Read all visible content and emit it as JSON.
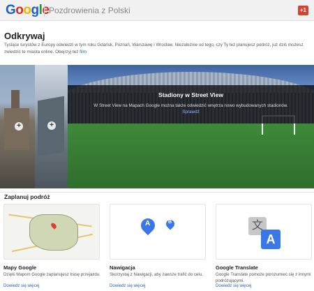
{
  "header": {
    "logo_letters": [
      "G",
      "o",
      "o",
      "g",
      "l",
      "e"
    ],
    "title": "Pozdrowienia z Polski",
    "gplus_label": "+1"
  },
  "discover": {
    "heading": "Odkrywaj",
    "intro": "Tysiące turystów z Europy odwiedzi w tym roku Gdańsk, Poznań, Warszawę i Wrocław. Niezależnie od tego, czy Ty też planujesz podróż, już dziś możesz zwiedzić te miasta online. Obejrzyj też ",
    "intro_link": "film"
  },
  "carousel": {
    "caption_title": "Stadiony w Street View",
    "caption_desc": "W Street View na Mapach Google można także odwiedzić wnętrza nowo wybudowanych stadionów.",
    "caption_link": "Sprawdź",
    "thumb_button": "+"
  },
  "plan": {
    "heading": "Zaplanuj podróż",
    "cards": [
      {
        "title": "Mapy Google",
        "desc": "Dzięki Mapom Google zaplanujesz trasę przejazdu.",
        "link": "Dowiedz się więcej",
        "icon": "map-icon"
      },
      {
        "title": "Nawigacja",
        "desc": "Skorzystaj z Nawigacji, aby zawsze trafić do celu.",
        "link": "Dowiedz się więcej",
        "icon": "navigation-pins-icon",
        "pin_a": "A",
        "pin_b": "B"
      },
      {
        "title": "Google Translate",
        "desc": "Google Translate pomoże porozumieć się z innymi podróżującymi.",
        "link": "Dowiedz się więcej",
        "icon": "translate-icon",
        "glyph_1": "文",
        "glyph_2": "A"
      }
    ]
  },
  "colors": {
    "link": "#2a5db0",
    "gplus": "#d8432f",
    "brand_blue": "#3b78e7"
  }
}
